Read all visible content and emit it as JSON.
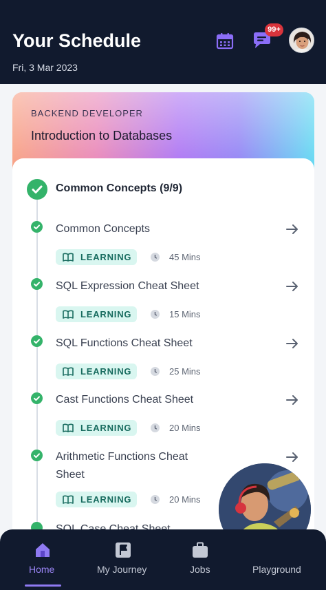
{
  "header": {
    "title": "Your Schedule",
    "date": "Fri, 3 Mar 2023",
    "notification_badge": "99+",
    "icons": [
      "calendar-icon",
      "chat-icon",
      "user-avatar"
    ]
  },
  "course": {
    "track": "BACKEND DEVELOPER",
    "name": "Introduction to Databases"
  },
  "section": {
    "title": "Common Concepts (9/9)"
  },
  "items": [
    {
      "title": "Common Concepts",
      "type": "LEARNING",
      "duration": "45 Mins"
    },
    {
      "title": "SQL Expression Cheat Sheet",
      "type": "LEARNING",
      "duration": "15 Mins"
    },
    {
      "title": "SQL Functions Cheat Sheet",
      "type": "LEARNING",
      "duration": "25 Mins"
    },
    {
      "title": "Cast Functions Cheat Sheet",
      "type": "LEARNING",
      "duration": "20 Mins"
    },
    {
      "title": "Arithmetic Functions Cheat Sheet",
      "type": "LEARNING",
      "duration": "20 Mins"
    }
  ],
  "peek_item": "SQL Case Cheat Sheet",
  "nav": {
    "home": "Home",
    "journey": "My Journey",
    "jobs": "Jobs",
    "playground": "Playground",
    "active": "home"
  },
  "colors": {
    "header_bg": "#111a2e",
    "success": "#34b36a",
    "pill_bg": "#d9f6f0",
    "pill_text": "#176b5e",
    "accent": "#8f7af2",
    "badge": "#d9343c"
  }
}
